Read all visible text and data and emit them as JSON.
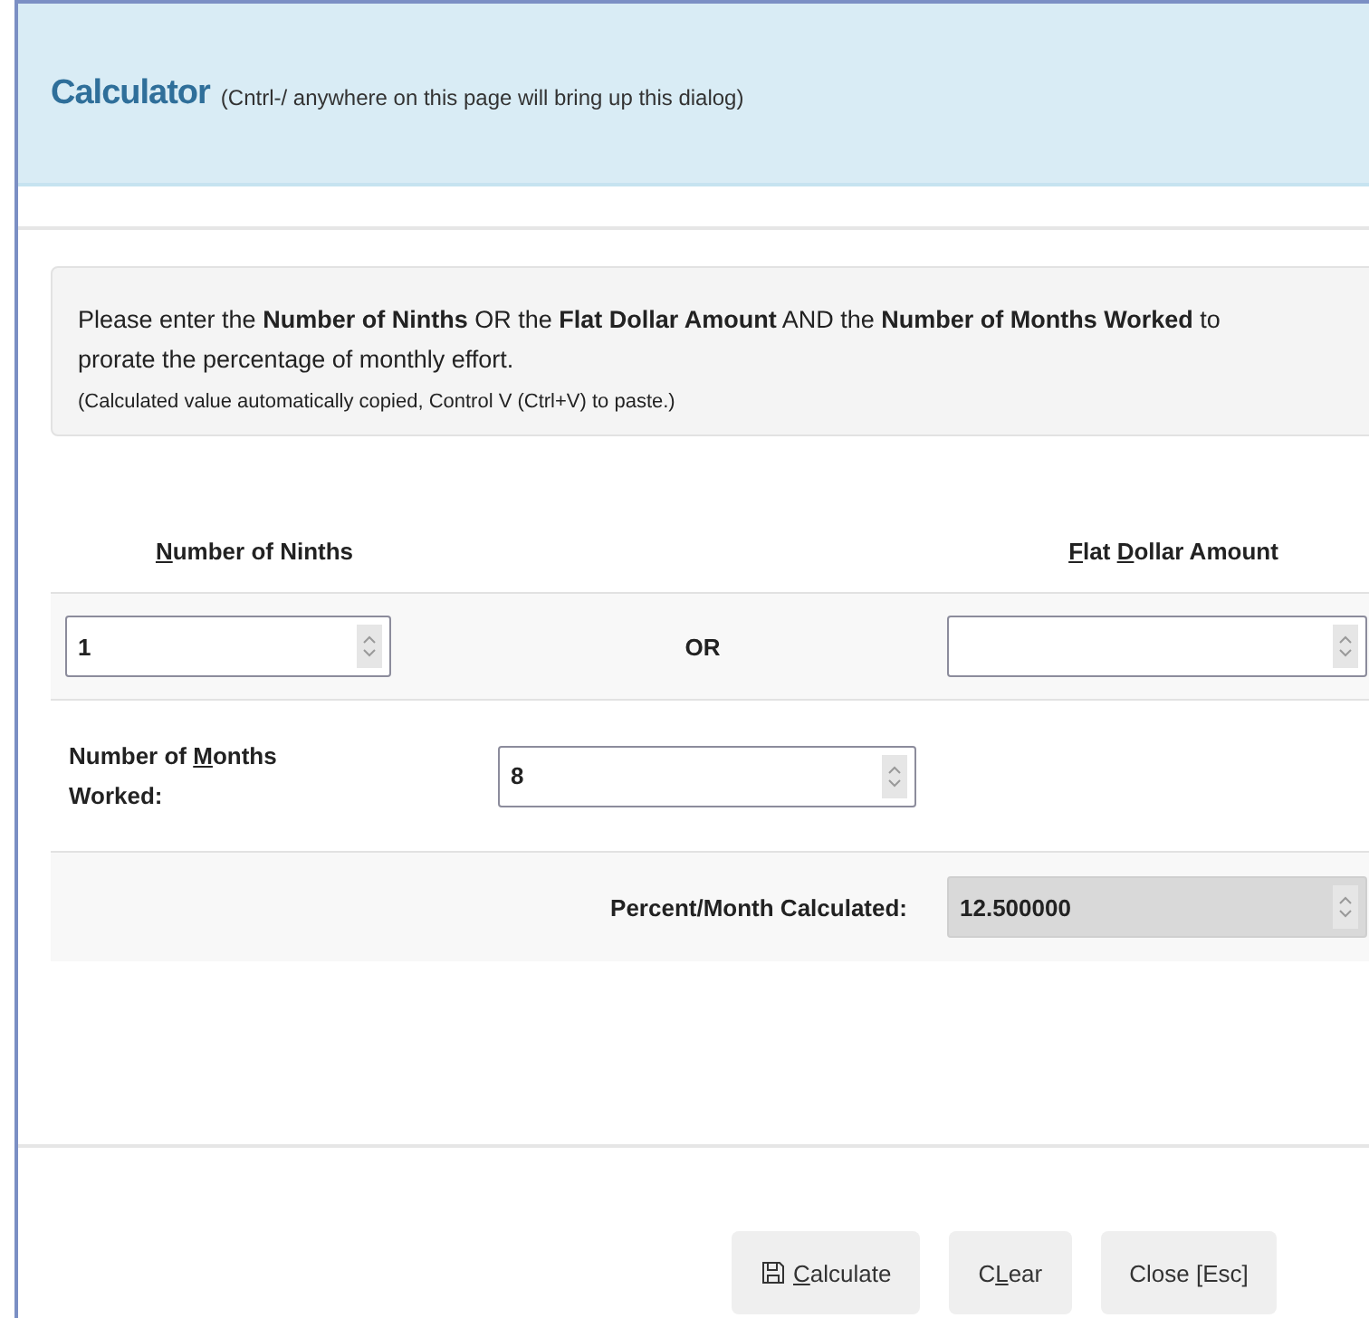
{
  "dialog": {
    "title": "Calculator",
    "subtitle": "(Cntrl-/ anywhere on this page will bring up this dialog)"
  },
  "info": {
    "message": "Please enter the **Number of Ninths** OR the **Flat Dollar Amount** AND the **Number of Months Worked** to prorate the percentage of monthly effort.",
    "note": "(Calculated value automatically copied, Control V (Ctrl+V) to paste.)"
  },
  "form": {
    "ninths_header": [
      {
        "text": "N",
        "underlined": true
      },
      {
        "text": "umber of Ninths",
        "underlined": false
      }
    ],
    "flat_header": [
      {
        "text": "F",
        "underlined": true
      },
      {
        "text": "lat ",
        "underlined": false
      },
      {
        "text": "D",
        "underlined": true
      },
      {
        "text": "ollar Amount",
        "underlined": false
      }
    ],
    "ninths_value": "1",
    "or_label": "OR",
    "months_label": [
      {
        "text": "Number of ",
        "underlined": false
      },
      {
        "text": "M",
        "underlined": true
      },
      {
        "text": "onths Worked:",
        "underlined": false
      }
    ],
    "months_value": "8",
    "percent_label": "Percent/Month Calculated:",
    "percent_value": "12.500000",
    "percent_disabled": true
  },
  "buttons": [
    {
      "kind": "save",
      "parts": [
        {
          "text": "C",
          "underlined": true
        },
        {
          "text": "alculate",
          "underlined": false
        }
      ]
    },
    {
      "kind": "plain",
      "parts": [
        {
          "text": "C",
          "underlined": false
        },
        {
          "text": "L",
          "underlined": true
        },
        {
          "text": "ear",
          "underlined": false
        }
      ]
    },
    {
      "kind": "plain",
      "parts": [
        {
          "text": "Close [Esc]",
          "underlined": false
        }
      ]
    }
  ]
}
